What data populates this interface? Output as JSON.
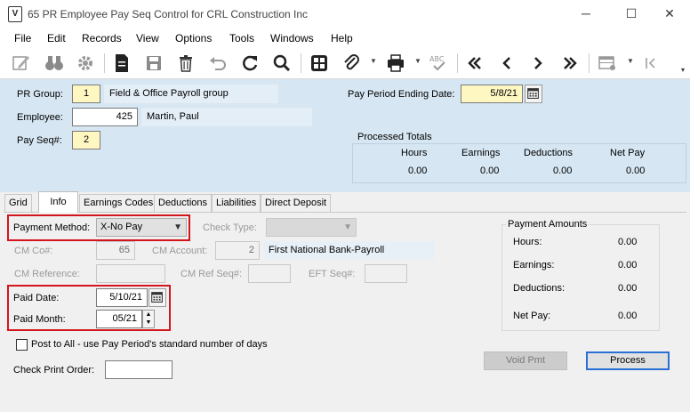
{
  "window": {
    "title": "65 PR Employee Pay Seq Control for CRL Construction Inc",
    "app_icon_glyph": "V",
    "minimize": "─",
    "maximize": "☐",
    "close": "✕"
  },
  "menu": [
    "File",
    "Edit",
    "Records",
    "View",
    "Options",
    "Tools",
    "Windows",
    "Help"
  ],
  "header": {
    "pr_group_label": "PR Group:",
    "pr_group_value": "1",
    "pr_group_desc": "Field & Office Payroll group",
    "employee_label": "Employee:",
    "employee_value": "425",
    "employee_desc": "Martin, Paul",
    "pay_seq_label": "Pay Seq#:",
    "pay_seq_value": "2",
    "pay_period_label": "Pay Period Ending Date:",
    "pay_period_value": "5/8/21",
    "processed_totals_label": "Processed Totals",
    "totals": [
      {
        "label": "Hours",
        "value": "0.00"
      },
      {
        "label": "Earnings",
        "value": "0.00"
      },
      {
        "label": "Deductions",
        "value": "0.00"
      },
      {
        "label": "Net Pay",
        "value": "0.00"
      }
    ]
  },
  "tabs": [
    "Grid",
    "Info",
    "Earnings Codes",
    "Deductions",
    "Liabilities",
    "Direct Deposit"
  ],
  "active_tab": "Info",
  "info": {
    "payment_method_label": "Payment Method:",
    "payment_method_value": "X-No Pay",
    "check_type_label": "Check Type:",
    "check_type_value": "",
    "cm_co_label": "CM Co#:",
    "cm_co_value": "65",
    "cm_account_label": "CM Account:",
    "cm_account_value": "2",
    "cm_account_desc": "First National Bank-Payroll",
    "cm_reference_label": "CM Reference:",
    "cm_reference_value": "",
    "cm_ref_seq_label": "CM Ref Seq#:",
    "cm_ref_seq_value": "",
    "eft_seq_label": "EFT Seq#:",
    "eft_seq_value": "",
    "paid_date_label": "Paid Date:",
    "paid_date_value": "5/10/21",
    "paid_month_label": "Paid Month:",
    "paid_month_value": "05/21",
    "post_to_all_label": "Post to All - use Pay Period's standard number of days",
    "post_to_all_checked": false,
    "check_print_order_label": "Check Print Order:",
    "check_print_order_value": ""
  },
  "payment_amounts": {
    "title": "Payment Amounts",
    "hours_label": "Hours:",
    "hours_value": "0.00",
    "earnings_label": "Earnings:",
    "earnings_value": "0.00",
    "deductions_label": "Deductions:",
    "deductions_value": "0.00",
    "net_pay_label": "Net Pay:",
    "net_pay_value": "0.00"
  },
  "buttons": {
    "void_pmt": "Void Pmt",
    "process": "Process"
  },
  "colors": {
    "highlight_red": "#d4161c",
    "header_bg": "#d6e6f2",
    "required_yellow": "#fff7c2",
    "process_border": "#2a6fd6"
  }
}
